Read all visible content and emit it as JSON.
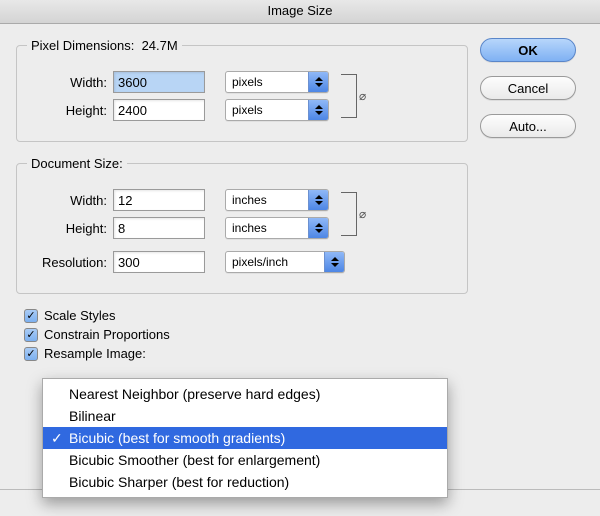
{
  "title": "Image Size",
  "buttons": {
    "ok": "OK",
    "cancel": "Cancel",
    "auto": "Auto..."
  },
  "pixel": {
    "legendPrefix": "Pixel Dimensions:",
    "size": "24.7M",
    "widthLabel": "Width:",
    "widthValue": "3600",
    "widthUnit": "pixels",
    "heightLabel": "Height:",
    "heightValue": "2400",
    "heightUnit": "pixels"
  },
  "doc": {
    "legend": "Document Size:",
    "widthLabel": "Width:",
    "widthValue": "12",
    "widthUnit": "inches",
    "heightLabel": "Height:",
    "heightValue": "8",
    "heightUnit": "inches",
    "resLabel": "Resolution:",
    "resValue": "300",
    "resUnit": "pixels/inch"
  },
  "checkboxes": {
    "scale": "Scale Styles",
    "constrain": "Constrain Proportions",
    "resample": "Resample Image:"
  },
  "dropdown": {
    "items": [
      {
        "label": "Nearest Neighbor (preserve hard edges)",
        "selected": false
      },
      {
        "label": "Bilinear",
        "selected": false
      },
      {
        "label": "Bicubic (best for smooth gradients)",
        "selected": true
      },
      {
        "label": "Bicubic Smoother (best for enlargement)",
        "selected": false
      },
      {
        "label": "Bicubic Sharper (best for reduction)",
        "selected": false
      }
    ]
  }
}
